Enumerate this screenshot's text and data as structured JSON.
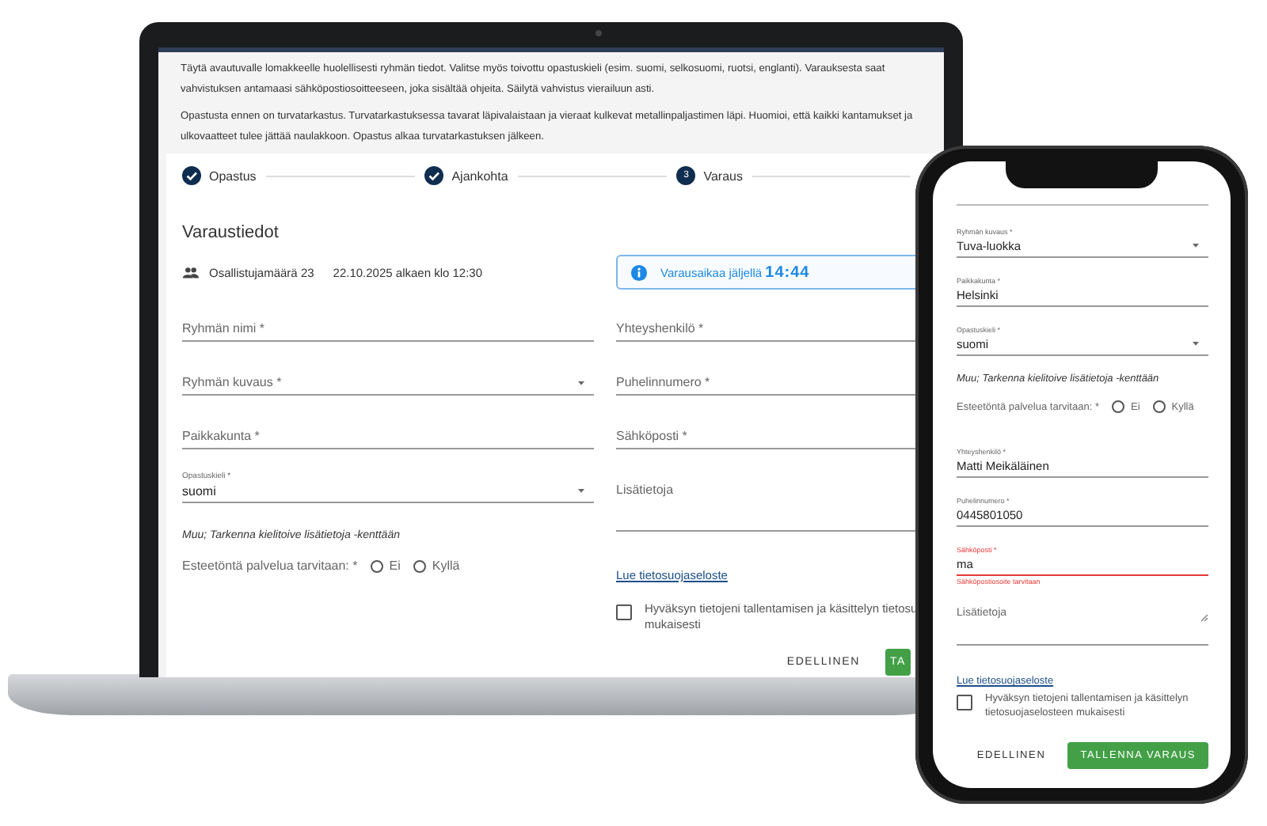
{
  "laptop": {
    "intro": [
      "Täytä avautuvalle lomakkeelle huolellisesti ryhmän tiedot. Valitse myös toivottu opastuskieli (esim. suomi, selkosuomi, ruotsi, englanti). Varauksesta saat vahvistuksen antamaasi sähköpostiosoitteeseen, joka sisältää ohjeita. Säilytä vahvistus vierailuun asti.",
      "Opastusta ennen on turvatarkastus. Turvatarkastuksessa tavarat läpivalaistaan ja vieraat kulkevat metallinpaljastimen läpi. Huomioi, että kaikki kantamukset ja ulkovaatteet tulee jättää naulakkoon. Opastus alkaa turvatarkastuksen jälkeen."
    ],
    "steps": [
      {
        "label": "Opastus",
        "completed": true
      },
      {
        "label": "Ajankohta",
        "completed": true
      },
      {
        "label": "Varaus",
        "completed": false,
        "number": "3"
      }
    ],
    "section_title": "Varaustiedot",
    "participants": "Osallistujamäärä 23",
    "date_time": "22.10.2025 alkaen klo 12:30",
    "timer": {
      "label": "Varausaikaa jäljellä",
      "time": "14:44"
    },
    "left_fields": [
      {
        "kind": "text",
        "label": "Ryhmän nimi *"
      },
      {
        "kind": "select",
        "label": "Ryhmän kuvaus *"
      },
      {
        "kind": "text",
        "label": "Paikkakunta *"
      },
      {
        "kind": "select",
        "label": "Opastuskieli *",
        "value": "suomi"
      }
    ],
    "note": "Muu; Tarkenna kielitoive lisätietoja -kenttään",
    "accessibility": {
      "question": "Esteetöntä palvelua tarvitaan: *",
      "options": [
        {
          "label": "Ei",
          "selected": false
        },
        {
          "label": "Kyllä",
          "selected": false
        }
      ]
    },
    "right_fields": [
      {
        "kind": "text",
        "label": "Yhteyshenkilö *"
      },
      {
        "kind": "text",
        "label": "Puhelinnumero *"
      },
      {
        "kind": "text",
        "label": "Sähköposti *"
      },
      {
        "kind": "textarea",
        "label": "Lisätietoja"
      }
    ],
    "privacy_link": "Lue tietosuojaseloste",
    "consent": {
      "label": "Hyväksyn tietojeni tallentamisen ja käsittelyn tietosu mukaisesti",
      "checked": false
    },
    "buttons": [
      {
        "label": "EDELLINEN",
        "kind": "text"
      },
      {
        "label": "TA",
        "kind": "primary"
      }
    ]
  },
  "phone": {
    "fields_top": [
      {
        "kind": "select",
        "label": "Ryhmän kuvaus *",
        "value": "Tuva-luokka"
      },
      {
        "kind": "text",
        "label": "Paikkakunta *",
        "value": "Helsinki"
      },
      {
        "kind": "select",
        "label": "Opastuskieli *",
        "value": "suomi"
      }
    ],
    "note": "Muu; Tarkenna kielitoive lisätietoja -kenttään",
    "accessibility": {
      "question": "Esteetöntä palvelua tarvitaan: *",
      "options": [
        {
          "label": "Ei",
          "selected": false
        },
        {
          "label": "Kyllä",
          "selected": false
        }
      ]
    },
    "fields_bottom": [
      {
        "kind": "text",
        "label": "Yhteyshenkilö *",
        "value": "Matti Meikäläinen"
      },
      {
        "kind": "text",
        "label": "Puhelinnumero *",
        "value": "0445801050"
      },
      {
        "kind": "text",
        "label": "Sähköposti *",
        "value": "ma",
        "error": "Sähköpostiosoite tarvitaan"
      },
      {
        "kind": "textarea",
        "label": "Lisätietoja"
      }
    ],
    "privacy_link": "Lue tietosuojaseloste",
    "consent": {
      "label": "Hyväksyn tietojeni tallentamisen ja käsittelyn tietosuojaselosteen mukaisesti",
      "checked": false
    },
    "buttons": [
      {
        "label": "EDELLINEN",
        "kind": "text"
      },
      {
        "label": "TALLENNA VARAUS",
        "kind": "primary"
      }
    ]
  }
}
